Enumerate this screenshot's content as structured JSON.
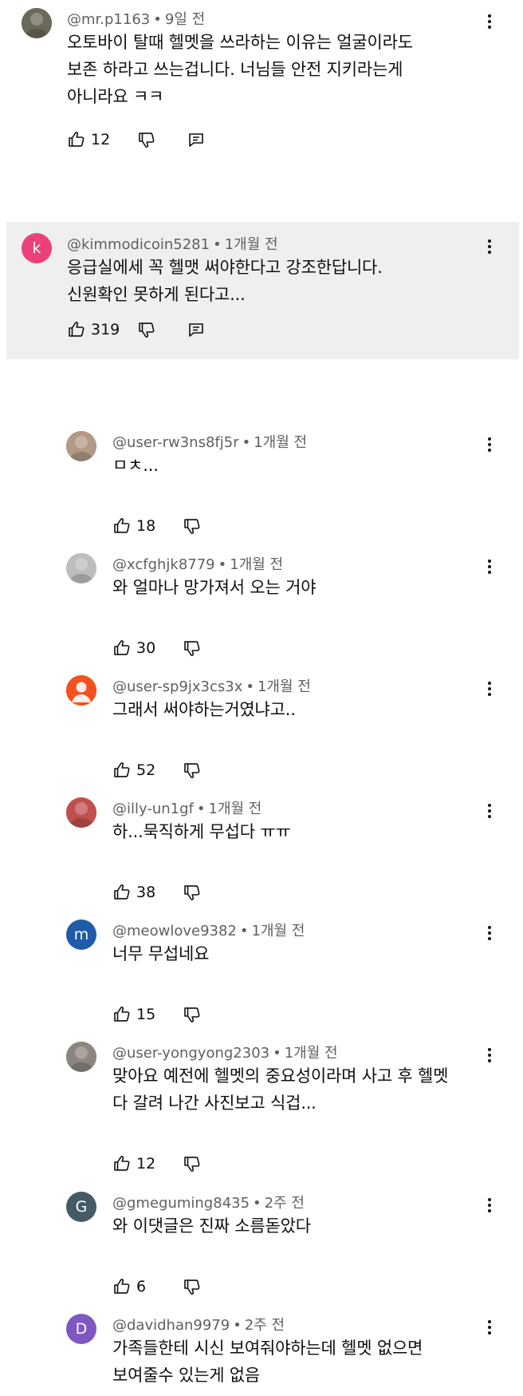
{
  "comments": [
    {
      "author": "@mr.p1163",
      "time": "9일 전",
      "text": "오토바이 탈때 헬멧을 쓰라하는 이유는 얼굴이라도\n보존 하라고 쓰는겁니다. 너님들 안전 지키라는게\n아니라요 ㅋㅋ",
      "likes": "12",
      "avatar": {
        "type": "photo",
        "color": "#6b6a5a"
      }
    },
    {
      "author": "@kimmodicoin5281",
      "time": "1개월 전",
      "text": "응급실에세 꼭 헬맷 써야한다고 강조한답니다.\n신원확인 못하게 된다고...",
      "likes": "319",
      "avatar": {
        "type": "letter",
        "letter": "k",
        "color": "#ec407a"
      }
    }
  ],
  "replies": [
    {
      "author": "@user-rw3ns8fj5r",
      "time": "1개월 전",
      "text": "ㅁㅊ...",
      "likes": "18",
      "avatar": {
        "type": "photo",
        "color": "#b39a86"
      }
    },
    {
      "author": "@xcfghjk8779",
      "time": "1개월 전",
      "text": "와 얼마나 망가져서 오는 거야",
      "likes": "30",
      "avatar": {
        "type": "photo",
        "color": "#bdbdbd"
      }
    },
    {
      "author": "@user-sp9jx3cs3x",
      "time": "1개월 전",
      "text": "그래서 써야하는거였냐고..",
      "likes": "52",
      "avatar": {
        "type": "default",
        "color": "#f4511e"
      }
    },
    {
      "author": "@illy-un1gf",
      "time": "1개월 전",
      "text": "하...묵직하게 무섭다 ㅠㅠ",
      "likes": "38",
      "avatar": {
        "type": "photo",
        "color": "#c0504d"
      }
    },
    {
      "author": "@meowlove9382",
      "time": "1개월 전",
      "text": "너무 무섭네요",
      "likes": "15",
      "avatar": {
        "type": "letter",
        "letter": "m",
        "color": "#1e5ba8"
      }
    },
    {
      "author": "@user-yongyong2303",
      "time": "1개월 전",
      "text": "맞아요 예전에 헬멧의 중요성이라며 사고 후 헬멧\n다 갈려 나간 사진보고 식겁...",
      "likes": "12",
      "avatar": {
        "type": "photo",
        "color": "#8d8680"
      }
    },
    {
      "author": "@gmeguming8435",
      "time": "2주 전",
      "text": "와 이댓글은 진짜 소름돋았다",
      "likes": "6",
      "avatar": {
        "type": "letter",
        "letter": "G",
        "color": "#455a64"
      }
    },
    {
      "author": "@davidhan9979",
      "time": "2주 전",
      "text": "가족들한테 시신 보여줘야하는데 헬멧 없으면\n보여줄수 있는게 없음",
      "likes": "",
      "avatar": {
        "type": "letter",
        "letter": "D",
        "color": "#7e57c2"
      }
    }
  ],
  "icons": {
    "like": "thumb-up-icon",
    "dislike": "thumb-down-icon",
    "reply": "comment-reply-icon",
    "more": "more-vertical-icon"
  }
}
